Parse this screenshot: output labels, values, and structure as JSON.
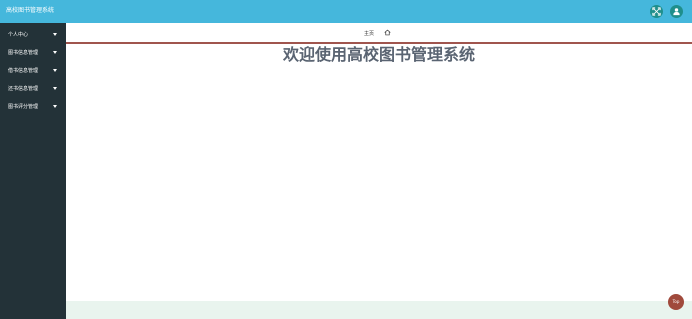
{
  "header": {
    "title": "高校图书管理系统",
    "buttons": [
      {
        "icon": "fullscreen-icon"
      },
      {
        "icon": "user-icon"
      }
    ],
    "background_color": "#45b7dc",
    "button_color": "#1f8f8c"
  },
  "sidebar": {
    "background_color": "#233238",
    "items": [
      {
        "label": "个人中心"
      },
      {
        "label": "图书信息管理"
      },
      {
        "label": "借书信息管理"
      },
      {
        "label": "还书信息管理"
      },
      {
        "label": "图书评分管理"
      }
    ]
  },
  "breadcrumb": {
    "home_label": "主页",
    "home_icon": "home-icon",
    "accent_color": "#a0554e"
  },
  "main": {
    "welcome_text": "欢迎使用高校图书管理系统",
    "welcome_color": "#5a6472"
  },
  "back_to_top": {
    "label": "Top",
    "color": "#a04a3c"
  }
}
